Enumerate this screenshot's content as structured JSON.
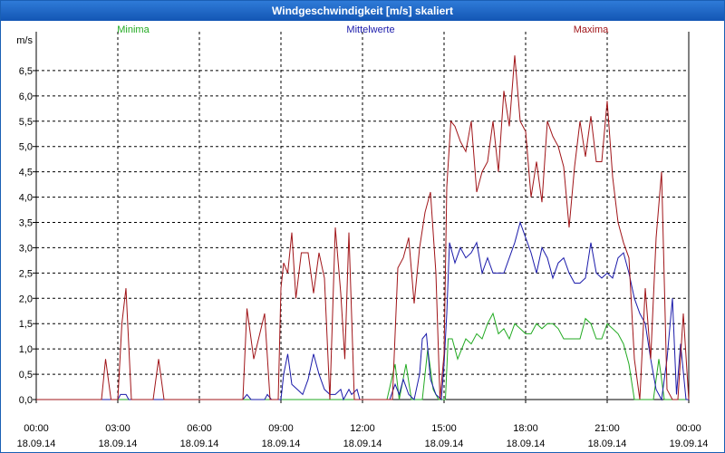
{
  "window": {
    "title": "Windgeschwindigkeit [m/s] skaliert"
  },
  "chart_data": {
    "type": "line",
    "title": "Windgeschwindigkeit [m/s] skaliert",
    "ylabel": "m/s",
    "ylim": [
      0,
      7.0
    ],
    "xlim_hours": [
      0,
      24
    ],
    "grid": true,
    "legend_position": "top",
    "y_ticks": [
      "0,0",
      "0,5",
      "1,0",
      "1,5",
      "2,0",
      "2,5",
      "3,0",
      "3,5",
      "4,0",
      "4,5",
      "5,0",
      "5,5",
      "6,0",
      "6,5"
    ],
    "x_ticks": [
      {
        "time": "00:00",
        "date": "18.09.14"
      },
      {
        "time": "03:00",
        "date": "18.09.14"
      },
      {
        "time": "06:00",
        "date": "18.09.14"
      },
      {
        "time": "09:00",
        "date": "18.09.14"
      },
      {
        "time": "12:00",
        "date": "18.09.14"
      },
      {
        "time": "15:00",
        "date": "18.09.14"
      },
      {
        "time": "18:00",
        "date": "18.09.14"
      },
      {
        "time": "21:00",
        "date": "18.09.14"
      },
      {
        "time": "00:00",
        "date": "19.09.14"
      }
    ],
    "series": [
      {
        "name": "Minima",
        "color": "#22aa22",
        "points": [
          [
            0,
            0
          ],
          [
            12.9,
            0
          ],
          [
            13.2,
            0.7
          ],
          [
            13.35,
            0
          ],
          [
            13.6,
            0.7
          ],
          [
            13.8,
            0
          ],
          [
            14.2,
            0
          ],
          [
            14.4,
            1.0
          ],
          [
            14.6,
            0.2
          ],
          [
            14.8,
            0
          ],
          [
            15.05,
            0
          ],
          [
            15.15,
            1.2
          ],
          [
            15.3,
            1.2
          ],
          [
            15.5,
            0.8
          ],
          [
            15.8,
            1.2
          ],
          [
            16.0,
            1.1
          ],
          [
            16.2,
            1.3
          ],
          [
            16.4,
            1.2
          ],
          [
            16.6,
            1.5
          ],
          [
            16.8,
            1.7
          ],
          [
            17.0,
            1.3
          ],
          [
            17.2,
            1.4
          ],
          [
            17.4,
            1.2
          ],
          [
            17.6,
            1.5
          ],
          [
            17.8,
            1.4
          ],
          [
            18.0,
            1.3
          ],
          [
            18.2,
            1.3
          ],
          [
            18.4,
            1.5
          ],
          [
            18.6,
            1.4
          ],
          [
            18.8,
            1.5
          ],
          [
            19.0,
            1.5
          ],
          [
            19.2,
            1.4
          ],
          [
            19.4,
            1.2
          ],
          [
            19.6,
            1.2
          ],
          [
            19.8,
            1.2
          ],
          [
            20.0,
            1.2
          ],
          [
            20.2,
            1.6
          ],
          [
            20.4,
            1.5
          ],
          [
            20.6,
            1.2
          ],
          [
            20.8,
            1.2
          ],
          [
            21.0,
            1.5
          ],
          [
            21.2,
            1.4
          ],
          [
            21.4,
            1.3
          ],
          [
            21.6,
            1.1
          ],
          [
            21.8,
            0.7
          ],
          [
            22.0,
            0
          ],
          [
            22.4,
            0
          ],
          [
            22.7,
            0
          ],
          [
            22.9,
            0.8
          ],
          [
            23.1,
            0
          ],
          [
            24,
            0
          ]
        ]
      },
      {
        "name": "Mittelwerte",
        "color": "#1a1aaa",
        "points": [
          [
            0,
            0
          ],
          [
            3.0,
            0
          ],
          [
            3.1,
            0.1
          ],
          [
            3.3,
            0.1
          ],
          [
            3.4,
            0
          ],
          [
            7.6,
            0
          ],
          [
            7.75,
            0.1
          ],
          [
            7.9,
            0
          ],
          [
            8.4,
            0
          ],
          [
            8.5,
            0.1
          ],
          [
            8.65,
            0
          ],
          [
            9.0,
            0
          ],
          [
            9.1,
            0.5
          ],
          [
            9.25,
            0.9
          ],
          [
            9.4,
            0.3
          ],
          [
            9.6,
            0.2
          ],
          [
            9.8,
            0.1
          ],
          [
            10.0,
            0.4
          ],
          [
            10.2,
            0.9
          ],
          [
            10.4,
            0.5
          ],
          [
            10.6,
            0.2
          ],
          [
            10.8,
            0.1
          ],
          [
            11.0,
            0.1
          ],
          [
            11.2,
            0.2
          ],
          [
            11.3,
            0
          ],
          [
            11.5,
            0.2
          ],
          [
            11.6,
            0.1
          ],
          [
            11.8,
            0.2
          ],
          [
            11.9,
            0
          ],
          [
            13.0,
            0
          ],
          [
            13.2,
            0.3
          ],
          [
            13.35,
            0.1
          ],
          [
            13.5,
            0.4
          ],
          [
            13.7,
            0.1
          ],
          [
            13.9,
            0
          ],
          [
            14.1,
            0.5
          ],
          [
            14.2,
            1.2
          ],
          [
            14.35,
            1.3
          ],
          [
            14.5,
            0.4
          ],
          [
            14.7,
            0.1
          ],
          [
            14.9,
            0
          ],
          [
            15.0,
            0.7
          ],
          [
            15.1,
            1.7
          ],
          [
            15.2,
            3.1
          ],
          [
            15.4,
            2.7
          ],
          [
            15.6,
            3.0
          ],
          [
            15.8,
            2.8
          ],
          [
            16.0,
            2.9
          ],
          [
            16.2,
            3.1
          ],
          [
            16.4,
            2.5
          ],
          [
            16.6,
            2.8
          ],
          [
            16.8,
            2.5
          ],
          [
            17.0,
            2.5
          ],
          [
            17.2,
            2.5
          ],
          [
            17.4,
            2.8
          ],
          [
            17.6,
            3.1
          ],
          [
            17.8,
            3.5
          ],
          [
            18.0,
            3.2
          ],
          [
            18.2,
            2.9
          ],
          [
            18.4,
            2.5
          ],
          [
            18.6,
            3.0
          ],
          [
            18.8,
            2.8
          ],
          [
            19.0,
            2.4
          ],
          [
            19.2,
            2.7
          ],
          [
            19.4,
            2.8
          ],
          [
            19.6,
            2.5
          ],
          [
            19.8,
            2.3
          ],
          [
            20.0,
            2.3
          ],
          [
            20.2,
            2.4
          ],
          [
            20.4,
            3.1
          ],
          [
            20.6,
            2.5
          ],
          [
            20.8,
            2.4
          ],
          [
            21.0,
            2.5
          ],
          [
            21.2,
            2.4
          ],
          [
            21.4,
            2.8
          ],
          [
            21.6,
            2.9
          ],
          [
            21.8,
            2.5
          ],
          [
            22.0,
            2.0
          ],
          [
            22.2,
            1.7
          ],
          [
            22.4,
            1.5
          ],
          [
            22.6,
            0.8
          ],
          [
            22.8,
            0.2
          ],
          [
            23.0,
            0
          ],
          [
            23.2,
            0.8
          ],
          [
            23.4,
            2.0
          ],
          [
            23.55,
            0.1
          ],
          [
            23.7,
            1.1
          ],
          [
            23.9,
            0
          ],
          [
            24,
            0
          ]
        ]
      },
      {
        "name": "Maxima",
        "color": "#a01418",
        "points": [
          [
            0,
            0
          ],
          [
            2.4,
            0
          ],
          [
            2.55,
            0.8
          ],
          [
            2.75,
            0
          ],
          [
            3.0,
            0
          ],
          [
            3.15,
            1.5
          ],
          [
            3.3,
            2.2
          ],
          [
            3.5,
            0
          ],
          [
            4.3,
            0
          ],
          [
            4.5,
            0.8
          ],
          [
            4.7,
            0
          ],
          [
            7.6,
            0
          ],
          [
            7.75,
            1.8
          ],
          [
            8.0,
            0.8
          ],
          [
            8.4,
            1.7
          ],
          [
            8.6,
            0
          ],
          [
            8.9,
            0
          ],
          [
            9.0,
            2.2
          ],
          [
            9.1,
            2.7
          ],
          [
            9.25,
            2.5
          ],
          [
            9.4,
            3.3
          ],
          [
            9.55,
            2.0
          ],
          [
            9.75,
            2.9
          ],
          [
            10.0,
            2.9
          ],
          [
            10.2,
            2.1
          ],
          [
            10.4,
            2.9
          ],
          [
            10.6,
            2.4
          ],
          [
            10.8,
            0
          ],
          [
            11.0,
            3.4
          ],
          [
            11.2,
            2.1
          ],
          [
            11.35,
            0.8
          ],
          [
            11.5,
            3.3
          ],
          [
            11.7,
            0
          ],
          [
            11.95,
            0
          ],
          [
            13.1,
            0
          ],
          [
            13.3,
            2.6
          ],
          [
            13.5,
            2.8
          ],
          [
            13.7,
            3.2
          ],
          [
            13.9,
            1.9
          ],
          [
            14.1,
            3.0
          ],
          [
            14.3,
            3.7
          ],
          [
            14.5,
            4.1
          ],
          [
            14.7,
            2.5
          ],
          [
            14.85,
            0
          ],
          [
            15.0,
            0.9
          ],
          [
            15.1,
            4.2
          ],
          [
            15.25,
            5.5
          ],
          [
            15.4,
            5.4
          ],
          [
            15.6,
            5.1
          ],
          [
            15.8,
            4.9
          ],
          [
            16.0,
            5.5
          ],
          [
            16.2,
            4.1
          ],
          [
            16.4,
            4.5
          ],
          [
            16.6,
            4.7
          ],
          [
            16.8,
            5.5
          ],
          [
            17.0,
            4.5
          ],
          [
            17.2,
            6.1
          ],
          [
            17.4,
            5.4
          ],
          [
            17.6,
            6.8
          ],
          [
            17.8,
            5.5
          ],
          [
            18.0,
            5.3
          ],
          [
            18.2,
            4.0
          ],
          [
            18.4,
            4.7
          ],
          [
            18.6,
            3.9
          ],
          [
            18.8,
            5.5
          ],
          [
            19.0,
            5.2
          ],
          [
            19.2,
            5.0
          ],
          [
            19.4,
            4.6
          ],
          [
            19.6,
            3.4
          ],
          [
            19.8,
            4.6
          ],
          [
            20.0,
            5.5
          ],
          [
            20.2,
            4.8
          ],
          [
            20.4,
            5.6
          ],
          [
            20.6,
            4.7
          ],
          [
            20.8,
            4.7
          ],
          [
            21.0,
            5.9
          ],
          [
            21.2,
            4.4
          ],
          [
            21.4,
            3.5
          ],
          [
            21.6,
            3.1
          ],
          [
            21.8,
            2.8
          ],
          [
            22.0,
            0.8
          ],
          [
            22.2,
            0
          ],
          [
            22.4,
            2.2
          ],
          [
            22.6,
            0.8
          ],
          [
            22.8,
            3.2
          ],
          [
            23.0,
            4.5
          ],
          [
            23.2,
            0.2
          ],
          [
            23.4,
            0
          ],
          [
            23.6,
            0
          ],
          [
            23.8,
            1.7
          ],
          [
            24,
            0
          ]
        ]
      }
    ]
  }
}
